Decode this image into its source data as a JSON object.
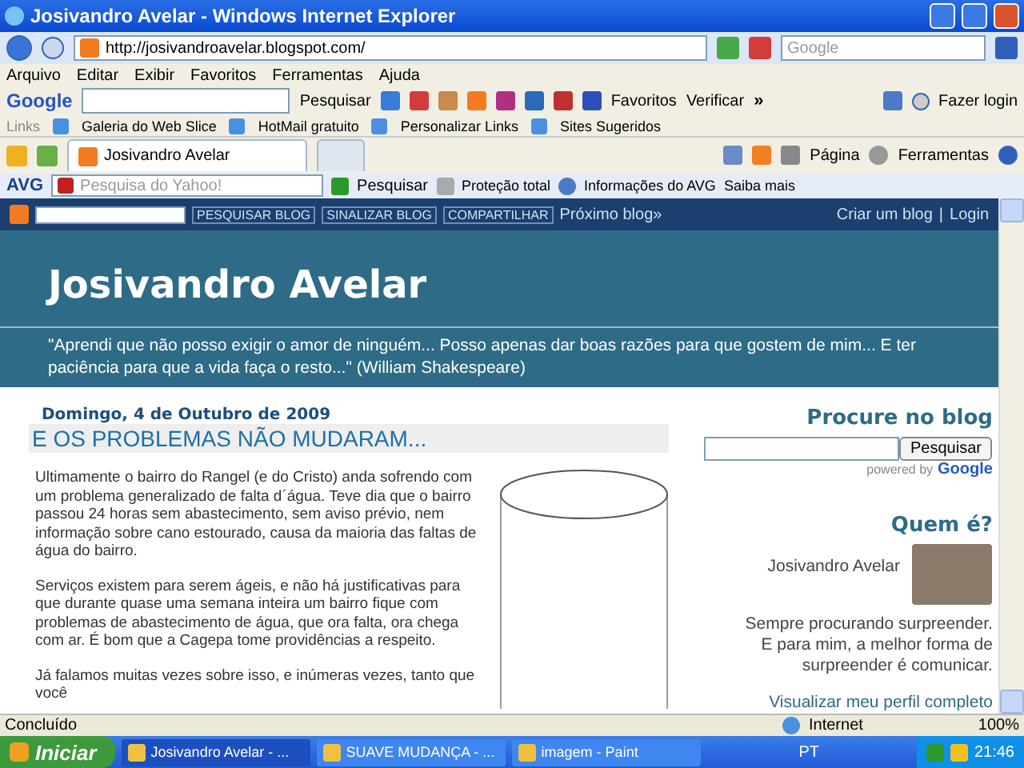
{
  "window": {
    "title": "Josivandro Avelar - Windows Internet Explorer"
  },
  "address_bar": {
    "url": "http://josivandroavelar.blogspot.com/",
    "search_placeholder": "Google"
  },
  "menu": [
    "Arquivo",
    "Editar",
    "Exibir",
    "Favoritos",
    "Ferramentas",
    "Ajuda"
  ],
  "google_toolbar": {
    "logo": "Google",
    "search_button": "Pesquisar",
    "favorites": "Favoritos",
    "check": "Verificar",
    "more": "»",
    "login": "Fazer login"
  },
  "links_bar": {
    "label": "Links",
    "items": [
      "Galeria do Web Slice",
      "HotMail gratuito",
      "Personalizar Links",
      "Sites Sugeridos"
    ]
  },
  "tabs": [
    {
      "label": "Josivandro Avelar",
      "selected": true
    }
  ],
  "command_bar": [
    "Página",
    "Ferramentas"
  ],
  "avg_toolbar": {
    "brand": "AVG",
    "search_placeholder": "Pesquisa do Yahoo!",
    "search_button": "Pesquisar",
    "items": [
      "Proteção total",
      "Informações do AVG",
      "Saiba mais"
    ]
  },
  "blog_navbar": {
    "buttons": [
      "PESQUISAR BLOG",
      "SINALIZAR BLOG",
      "COMPARTILHAR"
    ],
    "next": "Próximo blog»",
    "links": [
      "Criar um blog",
      "Login"
    ],
    "separator": "|"
  },
  "header": {
    "title": "Josivandro Avelar",
    "description": "\"Aprendi que não posso exigir o amor de ninguém... Posso apenas dar boas razões para que gostem de mim... E ter paciência para que a vida faça o resto...\" (William Shakespeare)"
  },
  "post": {
    "date": "Domingo, 4 de Outubro de 2009",
    "title": "E OS PROBLEMAS NÃO MUDARAM...",
    "paragraphs": [
      "Ultimamente o bairro do Rangel (e do Cristo) anda sofrendo com um problema  generalizado de falta d´água. Teve dia que o bairro passou 24 horas sem abastecimento, sem aviso prévio, nem informação sobre cano estourado, causa da maioria das faltas de água do bairro.",
      "Serviços existem para serem ágeis, e não há justificativas para que durante quase uma semana inteira um bairro fique com problemas de abastecimento de água, que ora falta, ora chega com ar. É bom que a Cagepa tome providências a respeito.",
      "Já falamos muitas vezes sobre isso, e inúmeras vezes, tanto que você"
    ]
  },
  "sidebar": {
    "search": {
      "title": "Procure no blog",
      "button": "Pesquisar",
      "powered": "powered by",
      "brand": "Google"
    },
    "profile": {
      "title": "Quem é?",
      "name": "Josivandro Avelar",
      "about": "Sempre procurando surpreender. E para mim, a melhor forma de surpreender é comunicar.",
      "link": "Visualizar meu perfil completo"
    }
  },
  "status_bar": {
    "text": "Concluído",
    "zone": "Internet",
    "zoom": "100%"
  },
  "taskbar": {
    "start": "Iniciar",
    "items": [
      {
        "label": "Josivandro Avelar - ...",
        "selected": true
      },
      {
        "label": "SUAVE MUDANÇA - ...",
        "selected": false
      },
      {
        "label": "imagem - Paint",
        "selected": false
      }
    ],
    "lang": "PT",
    "clock": "21:46"
  }
}
